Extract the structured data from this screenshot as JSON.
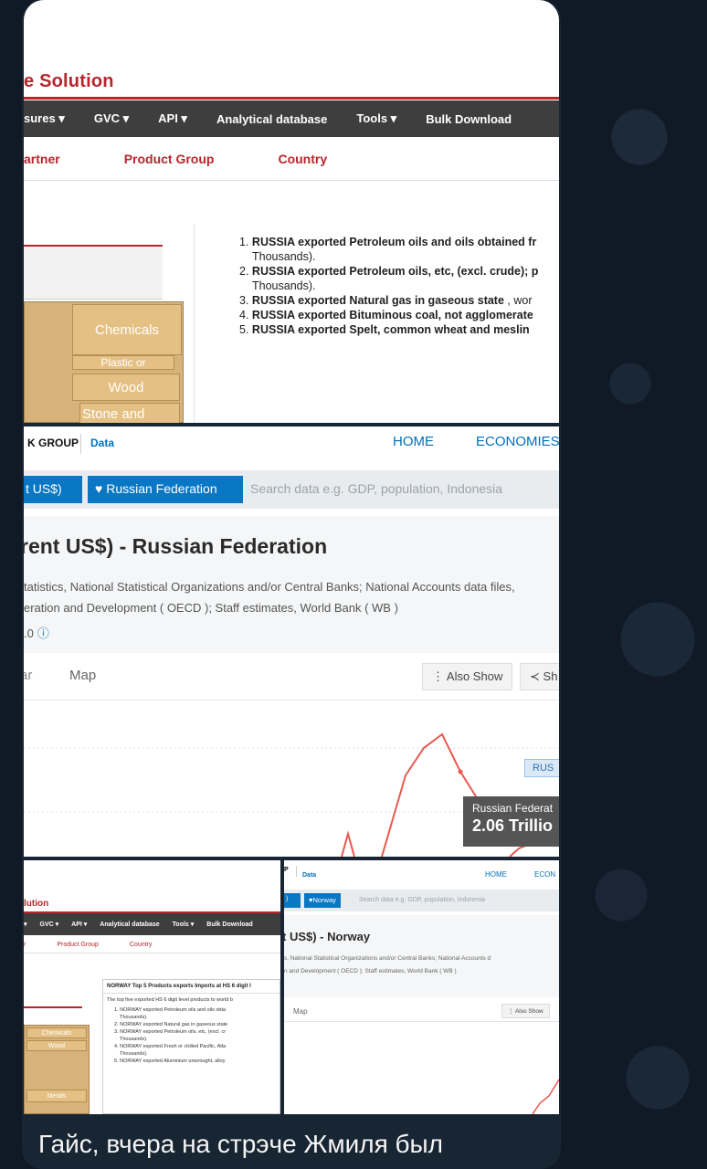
{
  "message": {
    "caption": "Гайс, вчера на стрэче Жмиля был"
  },
  "wits": {
    "title": "e Solution",
    "nav": [
      "sures ▾",
      "GVC ▾",
      "API ▾",
      "Analytical database",
      "Tools ▾",
      "Bulk Download"
    ],
    "subnav": [
      "artner",
      "Product Group",
      "Country"
    ],
    "treemap": [
      "Chemicals",
      "Plastic or",
      "Wood",
      "Stone and"
    ],
    "top_exports": [
      {
        "num": "1.",
        "bold": "RUSSIA exported Petroleum oils and oils obtained fr",
        "rest": ""
      },
      {
        "num": "",
        "bold": "",
        "rest": "Thousands)."
      },
      {
        "num": "2.",
        "bold": "RUSSIA exported Petroleum oils, etc, (excl. crude); p",
        "rest": ""
      },
      {
        "num": "",
        "bold": "",
        "rest": "Thousands)."
      },
      {
        "num": "3.",
        "bold": "RUSSIA exported Natural gas in gaseous state",
        "rest": " , wor"
      },
      {
        "num": "4.",
        "bold": "RUSSIA exported Bituminous coal, not agglomerate",
        "rest": ""
      },
      {
        "num": "5.",
        "bold": "RUSSIA exported Spelt, common wheat and meslin",
        "rest": ""
      }
    ]
  },
  "wb": {
    "brand": "K GROUP",
    "data_link": "Data",
    "home": "HOME",
    "economies": "ECONOMIES",
    "chip_indicator": "t US$)",
    "chip_country": "Russian Federation",
    "search_placeholder": "Search data e.g. GDP, population, Indonesia",
    "title": "rent US$) - Russian Federation",
    "source_line1": "tatistics, National Statistical Organizations and/or Central Banks; National Accounts data files,",
    "source_line2": "eration and Development ( OECD ); Staff estimates, World Bank ( WB )",
    "license": ".0",
    "tab_bar": "ar",
    "tab_map": "Map",
    "also_show": "Also Show",
    "share": "Sh",
    "legend": "RUS",
    "tooltip_name": "Russian Federat",
    "tooltip_value": "2.06 Trillio"
  },
  "wits_small": {
    "title": "lution",
    "nav": [
      "▾",
      "GVC ▾",
      "API ▾",
      "Analytical database",
      "Tools ▾",
      "Bulk Download"
    ],
    "subnav": [
      "r",
      "Product Group",
      "Country"
    ],
    "panel_title": "NORWAY Top 5 Products exports Imports at HS 6 digit l",
    "panel_intro": "The top five exported HS 6 digit level products to world b",
    "items": [
      "1. NORWAY exported Petroleum oils and oils obta",
      "Thousands).",
      "2. NORWAY exported Natural gas in gaseous state",
      "3. NORWAY exported Petroleum oils, etc, (excl. cr",
      "Thousands).",
      "4. NORWAY exported Fresh or chilled Pacific, Atla",
      "Thousands).",
      "5. NORWAY exported Aluminium unwrought, alloy"
    ],
    "treemap": [
      "Chemicals",
      "Wood",
      "Metals"
    ]
  },
  "wb_small": {
    "data_link": "Data",
    "home": "HOME",
    "economies": "ECON",
    "chip_country": "Norway",
    "search_placeholder": "Search data e.g. GDP, population, Indonesia",
    "title": "t US$) - Norway",
    "source_line1": "s, National Statistical Organizations and/or Central Banks; National Accounts d",
    "source_line2": "n and Development ( OECD ); Staff estimates, World Bank ( WB )",
    "tab_map": "Map",
    "also_show": "Also Show"
  },
  "colors": {
    "wits_red": "#b5262b",
    "wb_blue": "#0071bc",
    "chart_line": "#e8594f",
    "bubble": "#182533"
  }
}
